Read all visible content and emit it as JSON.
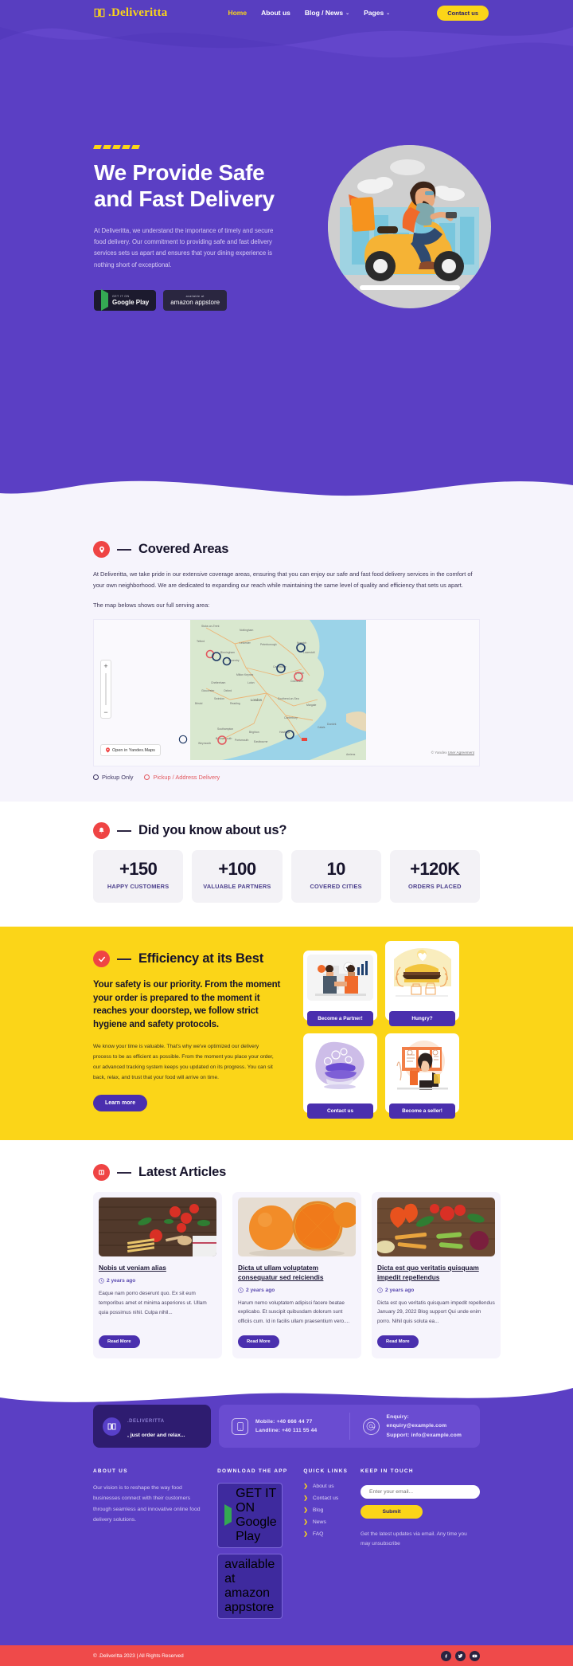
{
  "brand": {
    "name": ".Deliveritta",
    "icon": "book-icon"
  },
  "nav": {
    "links": [
      {
        "label": "Home",
        "active": true,
        "caret": ""
      },
      {
        "label": "About us",
        "active": false,
        "caret": ""
      },
      {
        "label": "Blog / News",
        "active": false,
        "caret": "⌄"
      },
      {
        "label": "Pages",
        "active": false,
        "caret": "⌄"
      }
    ],
    "cta": "Contact us"
  },
  "hero": {
    "title": "We Provide Safe and Fast Delivery",
    "subtitle": "At Deliveritta, we understand the importance of timely and secure food delivery. Our commitment to providing safe and fast delivery services sets us apart and ensures that your dining experience is nothing short of exceptional.",
    "badges": [
      {
        "small": "GET IT ON",
        "large": "Google Play",
        "icon": "google-play-icon"
      },
      {
        "small": "available at",
        "large": "amazon appstore",
        "icon": "amazon-appstore-icon"
      }
    ]
  },
  "covered": {
    "icon": "location-pin-icon",
    "title": "Covered Areas",
    "paragraph1": "At Deliveritta, we take pride in our extensive coverage areas, ensuring that you can enjoy our safe and fast food delivery services in the comfort of your own neighborhood. We are dedicated to expanding our reach while maintaining the same level of quality and efficiency that sets us apart.",
    "paragraph2": "The map belows shows our full serving area:",
    "map": {
      "zoom_in": "+",
      "zoom_out": "−",
      "open_label": "Open in Yandex.Maps",
      "credit": "© Yandex",
      "credit_link": "User Agreement",
      "labels": [
        "Stoke-on-Trent",
        "Nottingham",
        "Telford",
        "Leicester",
        "Peterborough",
        "Norwich",
        "Lowestoft",
        "Birmingham",
        "Coventry",
        "Cambridge",
        "Ipswich",
        "Milton Keynes",
        "Colchester",
        "Cheltenham",
        "Luton",
        "Gloucester",
        "Oxford",
        "Swindon",
        "London",
        "Southend-on-Sea",
        "Bristol",
        "Reading",
        "Margate",
        "Canterbury",
        "Southampton",
        "Brighton",
        "Hastings",
        "Bournemouth",
        "Portsmouth",
        "Eastbourne",
        "Weymouth",
        "Calais",
        "Dunkirk",
        "Amiens"
      ]
    },
    "legend": [
      {
        "label": "Pickup Only",
        "color": "#3b3360"
      },
      {
        "label": "Pickup / Address Delivery",
        "color": "#E2585F"
      }
    ]
  },
  "stats": {
    "icon": "bell-icon",
    "title": "Did you know about us?",
    "cards": [
      {
        "number": "+150",
        "label": "HAPPY CUSTOMERS"
      },
      {
        "number": "+100",
        "label": "VALUABLE PARTNERS"
      },
      {
        "number": "10",
        "label": "COVERED CITIES"
      },
      {
        "number": "+120K",
        "label": "ORDERS PLACED"
      }
    ]
  },
  "efficiency": {
    "icon": "check-circle-icon",
    "title": "Efficiency at its Best",
    "lead": "Your safety is our priority. From the moment your order is prepared to the moment it reaches your doorstep, we follow strict hygiene and safety protocols.",
    "body": "We know your time is valuable. That's why we've optimized our delivery process to be as efficient as possible. From the moment you place your order, our advanced tracking system keeps you updated on its progress. You can sit back, relax, and trust that your food will arrive on time.",
    "cta": "Learn more",
    "promos": [
      {
        "button": "Become a Partner!",
        "image": "handshake-illustration"
      },
      {
        "button": "Contact us",
        "image": "food-bowl-illustration"
      },
      {
        "button": "Hungry?",
        "image": "burger-hands-illustration"
      },
      {
        "button": "Become a seller!",
        "image": "shop-owner-illustration"
      }
    ]
  },
  "articles": {
    "icon": "news-icon",
    "title": "Latest Articles",
    "read_more": "Read More",
    "items": [
      {
        "title": "Nobis ut veniam alias",
        "date": "2 years ago",
        "excerpt": "Eaque nam porro deserunt quo. Ex sit eum temporibus amet et minima asperiores ut. Ullam quia possimus nihil. Culpa nihil...",
        "image": "tomatoes-pasta-photo"
      },
      {
        "title": "Dicta ut ullam voluptatem consequatur sed reiciendis",
        "date": "2 years ago",
        "excerpt": "Harum nemo voluptatem adipisci facere beatae explicabo. Et suscipit quibusdam dolorum sunt officiis cum. Id in facilis ullam praesentium vero....",
        "image": "oranges-photo"
      },
      {
        "title": "Dicta est quo veritatis quisquam impedit repellendus",
        "date": "2 years ago",
        "excerpt": "Dicta est quo veritatis quisquam impedit repellendus January 29, 2022 Blog support Qui unde enim porro. Nihil quis soluta ea...",
        "image": "vegetables-photo"
      }
    ]
  },
  "footer": {
    "contactbar": {
      "brand_name": ".DELIVERITTA",
      "brand_tagline": ", just order and relax...",
      "phone": {
        "icon": "phone-icon",
        "line1": "Mobile:  +40 666 44 77",
        "line2": "Landline: +40 111 55 44"
      },
      "email": {
        "icon": "at-icon",
        "line1": "Enquiry:  enquiry@example.com",
        "line2": "Support:  info@example.com"
      }
    },
    "about": {
      "heading": "ABOUT US",
      "text": "Our vision is to reshape the way food businesses connect with their customers through seamless and innovative online food delivery solutions."
    },
    "download": {
      "heading": "DOWNLOAD THE APP",
      "badges": [
        {
          "small": "GET IT ON",
          "large": "Google Play",
          "icon": "google-play-icon"
        },
        {
          "small": "available at",
          "large": "amazon appstore",
          "icon": "amazon-appstore-icon"
        }
      ]
    },
    "quick": {
      "heading": "QUICK LINKS",
      "links": [
        "About us",
        "Contact us",
        "Blog",
        "News",
        "FAQ"
      ]
    },
    "touch": {
      "heading": "KEEP IN TOUCH",
      "placeholder": "Enter your email...",
      "value": "",
      "submit": "Submit",
      "note": "Get the latest updates via email. Any time you may unsubscribe"
    },
    "copyright": "© .Deliveritta 2023 | All Rights Reserved",
    "socials": [
      {
        "name": "facebook-icon",
        "glyph": "f"
      },
      {
        "name": "twitter-icon",
        "glyph": "•"
      },
      {
        "name": "youtube-icon",
        "glyph": "▶"
      }
    ]
  },
  "colors": {
    "purple": "#5B3FC4",
    "deep_purple": "#4A2FAE",
    "yellow": "#FBD518",
    "red": "#EF4444",
    "copy_red": "#EF4A4A"
  }
}
